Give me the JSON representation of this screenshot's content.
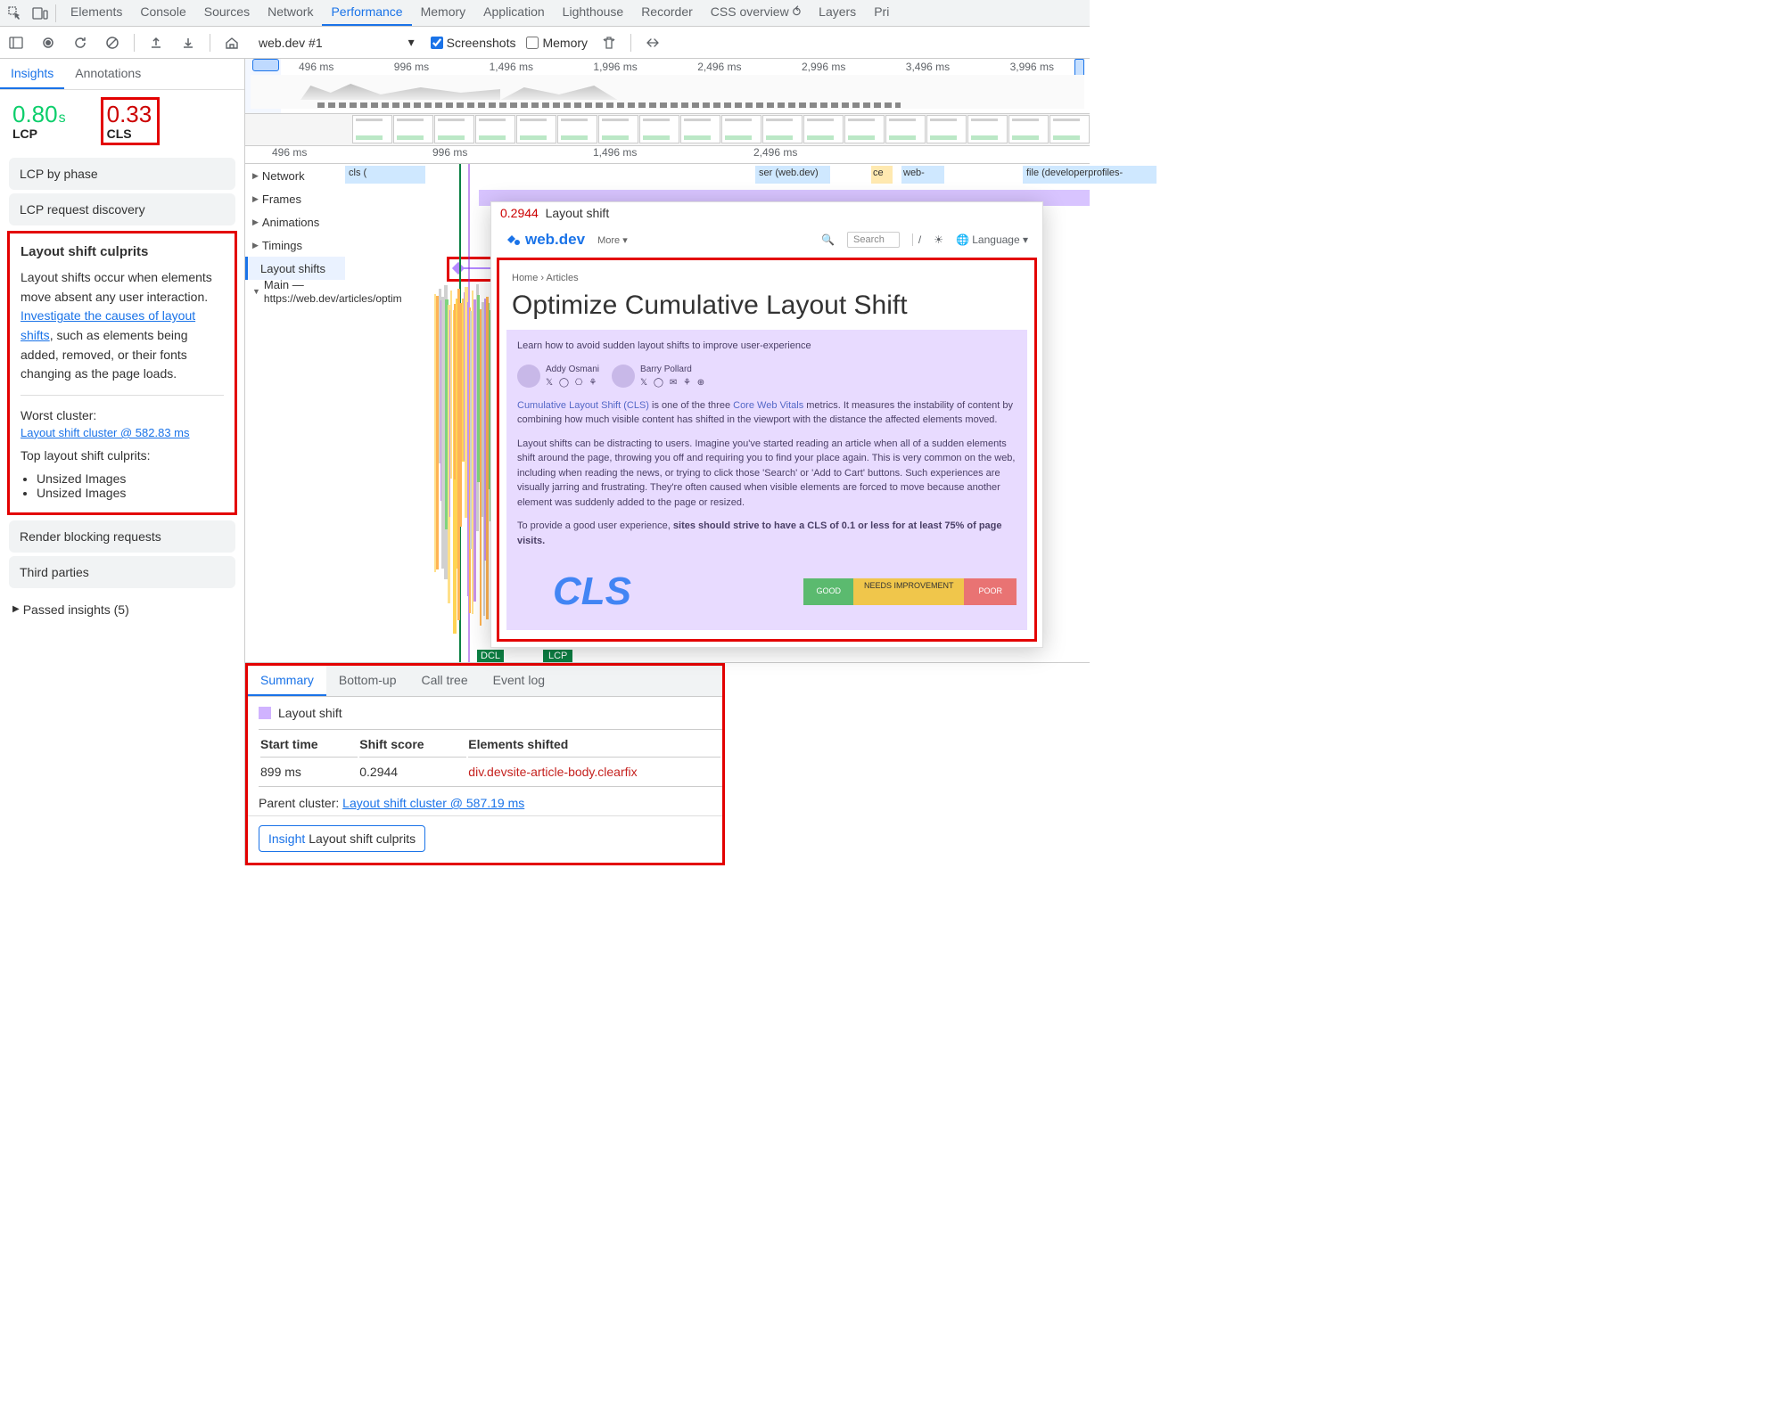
{
  "topTabs": {
    "items": [
      "Elements",
      "Console",
      "Sources",
      "Network",
      "Performance",
      "Memory",
      "Application",
      "Lighthouse",
      "Recorder",
      "CSS overview ⥀",
      "Layers",
      "Pri"
    ],
    "activeIndex": 4
  },
  "toolbar": {
    "trace_label": "web.dev #1",
    "screenshots_label": "Screenshots",
    "screenshots_checked": true,
    "memory_label": "Memory",
    "memory_checked": false
  },
  "minimapTicks": [
    "496 ms",
    "996 ms",
    "1,496 ms",
    "1,996 ms",
    "2,496 ms",
    "2,996 ms",
    "3,496 ms",
    "3,996 ms"
  ],
  "timelineTicks": [
    "496 ms",
    "996 ms",
    "1,496 ms",
    "2,496 ms"
  ],
  "leftTabs": {
    "insights": "Insights",
    "annotations": "Annotations"
  },
  "metrics": {
    "lcp_value": "0.80",
    "lcp_unit": "s",
    "lcp_label": "LCP",
    "cls_value": "0.33",
    "cls_label": "CLS"
  },
  "accordions": {
    "lcp_phase": "LCP by phase",
    "lcp_discovery": "LCP request discovery",
    "render_block": "Render blocking requests",
    "third_parties": "Third parties"
  },
  "culprits": {
    "heading": "Layout shift culprits",
    "para1_a": "Layout shifts occur when elements move absent any user interaction. ",
    "link1": "Investigate the causes of layout shifts",
    "para1_b": ", such as elements being added, removed, or their fonts changing as the page loads.",
    "worst_label": "Worst cluster:",
    "worst_link": "Layout shift cluster @ 582.83 ms",
    "top_label": "Top layout shift culprits:",
    "bullet1": "Unsized Images",
    "bullet2": "Unsized Images"
  },
  "passed_label": "Passed insights (5)",
  "tracks": {
    "network": "Network",
    "network_item": "cls (",
    "frames": "Frames",
    "animations": "Animations",
    "timings": "Timings",
    "layout_shifts": "Layout shifts",
    "main_prefix": "Main — ",
    "main_url": "https://web.dev/articles/optim",
    "net_ser": "ser (web.dev)",
    "net_ce": "ce",
    "net_web": "web-",
    "net_file": "file (developerprofiles-"
  },
  "markers": {
    "dcl": "DCL",
    "lcp": "LCP"
  },
  "hover": {
    "score": "0.2944",
    "title": "Layout shift",
    "page_title": "web.dev",
    "menu_more": "More ▾",
    "search_ph": "Search",
    "lang": "Language ▾",
    "bread_home": "Home",
    "bread_sep": "›",
    "bread_art": "Articles",
    "h1": "Optimize Cumulative Layout Shift",
    "lead": "Learn how to avoid sudden layout shifts to improve user-experience",
    "author1": "Addy Osmani",
    "author2": "Barry Pollard",
    "glyphs1": "𝕏 ◯ ⎔ ⚘",
    "glyphs2": "𝕏 ◯ ✉ ⚘ ⊕",
    "p1_a": "Cumulative Layout Shift (CLS)",
    "p1_b": " is one of the three ",
    "p1_c": "Core Web Vitals",
    "p1_d": " metrics. It measures the instability of content by combining how much visible content has shifted in the viewport with the distance the affected elements moved.",
    "p2": "Layout shifts can be distracting to users. Imagine you've started reading an article when all of a sudden elements shift around the page, throwing you off and requiring you to find your place again. This is very common on the web, including when reading the news, or trying to click those 'Search' or 'Add to Cart' buttons. Such experiences are visually jarring and frustrating. They're often caused when visible elements are forced to move because another element was suddenly added to the page or resized.",
    "p3_a": "To provide a good user experience, ",
    "p3_b": "sites should strive to have a CLS of 0.1 or less for at least 75% of page visits.",
    "cls_big": "CLS",
    "good": "GOOD",
    "needs": "NEEDS IMPROVEMENT",
    "poor": "POOR"
  },
  "bottomTabs": {
    "summary": "Summary",
    "bottomup": "Bottom-up",
    "calltree": "Call tree",
    "eventlog": "Event log"
  },
  "summary": {
    "heading": "Layout shift",
    "col_start": "Start time",
    "col_score": "Shift score",
    "col_elem": "Elements shifted",
    "start_val": "899 ms",
    "score_val": "0.2944",
    "elem_val": "div.devsite-article-body.clearfix",
    "parent_label": "Parent cluster: ",
    "parent_link": "Layout shift cluster @ 587.19 ms",
    "insight_chip_label": "Insight",
    "insight_chip_text": "Layout shift culprits"
  }
}
